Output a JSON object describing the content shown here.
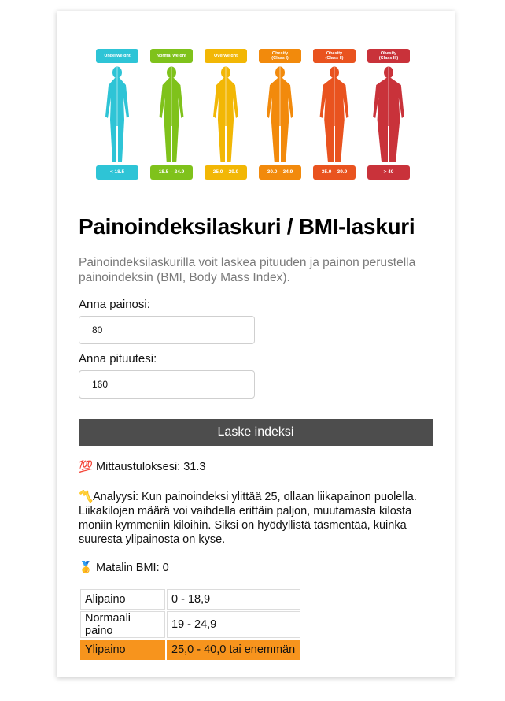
{
  "colors": {
    "underweight": "#2ec4d6",
    "normal": "#7fc21b",
    "overweight": "#f2b705",
    "obesity1": "#f28a0c",
    "obesity2": "#e9531f",
    "obesity3": "#c9323a",
    "button_bg": "#4d4d4d",
    "highlight": "#f7941d"
  },
  "chart": {
    "categories": [
      {
        "top": "Underweight",
        "range": "< 18.5"
      },
      {
        "top": "Normal weight",
        "range": "18.5 – 24.9"
      },
      {
        "top": "Overweight",
        "range": "25.0 – 29.9"
      },
      {
        "top": "Obesity\n(Class I)",
        "range": "30.0 – 34.9"
      },
      {
        "top": "Obesity\n(Class II)",
        "range": "35.0 – 39.9"
      },
      {
        "top": "Obesity\n(Class III)",
        "range": "> 40"
      }
    ]
  },
  "page": {
    "title": "Painoindeksilaskuri / BMI-laskuri",
    "intro": "Painoindeksilaskurilla voit laskea pituuden ja painon perustella painoindeksin (BMI, Body Mass Index)."
  },
  "form": {
    "weight_label": "Anna painosi:",
    "weight_value": "80",
    "height_label": "Anna pituutesi:",
    "height_value": "160",
    "submit_label": "Laske indeksi"
  },
  "results": {
    "score_emoji": "💯",
    "score_text": "Mittaustuloksesi: 31.3",
    "analysis_emoji": "〽️",
    "analysis_text": "Analyysi: Kun painoindeksi ylittää 25, ollaan liikapainon puolella. Liikakilojen määrä voi vaihdella erittäin paljon, muutamasta kilosta moniin kymmeniin kiloihin. Siksi on hyödyllistä täsmentää, kuinka suuresta ylipainosta on kyse.",
    "min_emoji": "🥇",
    "min_text": "Matalin BMI: 0"
  },
  "table": {
    "rows": [
      {
        "label": "Alipaino",
        "range": "0 - 18,9"
      },
      {
        "label": "Normaali paino",
        "range": "19 - 24,9"
      },
      {
        "label": "Ylipaino",
        "range": "25,0 - 40,0 tai enemmän"
      }
    ]
  }
}
